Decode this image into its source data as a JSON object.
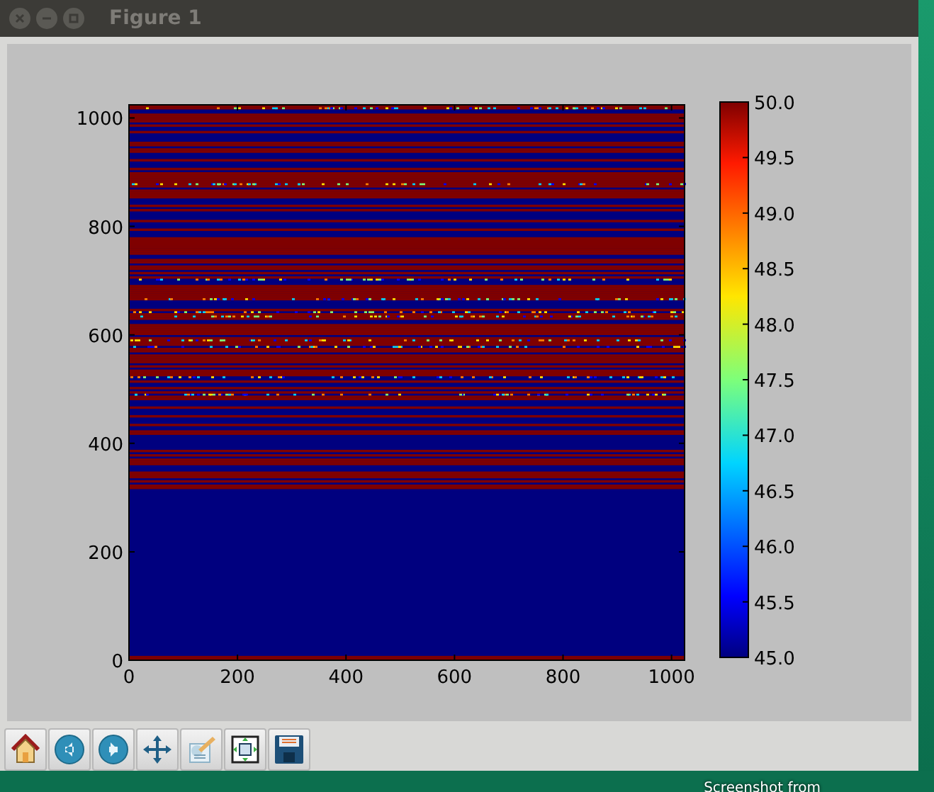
{
  "window": {
    "title": "Figure 1",
    "controls": [
      {
        "kind": "close"
      },
      {
        "kind": "minimize"
      },
      {
        "kind": "maximize"
      }
    ]
  },
  "figure": {
    "yticks": [
      "1000",
      "800",
      "600",
      "400",
      "200",
      "0"
    ],
    "xticks": [
      "0",
      "200",
      "400",
      "600",
      "800",
      "1000"
    ],
    "colorbar_ticks": [
      "50.0",
      "49.5",
      "49.0",
      "48.5",
      "48.0",
      "47.5",
      "47.0",
      "46.5",
      "46.0",
      "45.5",
      "45.0"
    ]
  },
  "toolbar": [
    {
      "kind": "home"
    },
    {
      "kind": "back"
    },
    {
      "kind": "forward"
    },
    {
      "kind": "pan"
    },
    {
      "kind": "edit"
    },
    {
      "kind": "frame"
    },
    {
      "kind": "save"
    }
  ],
  "desktop": {
    "icon_label": "Screenshot from"
  }
}
